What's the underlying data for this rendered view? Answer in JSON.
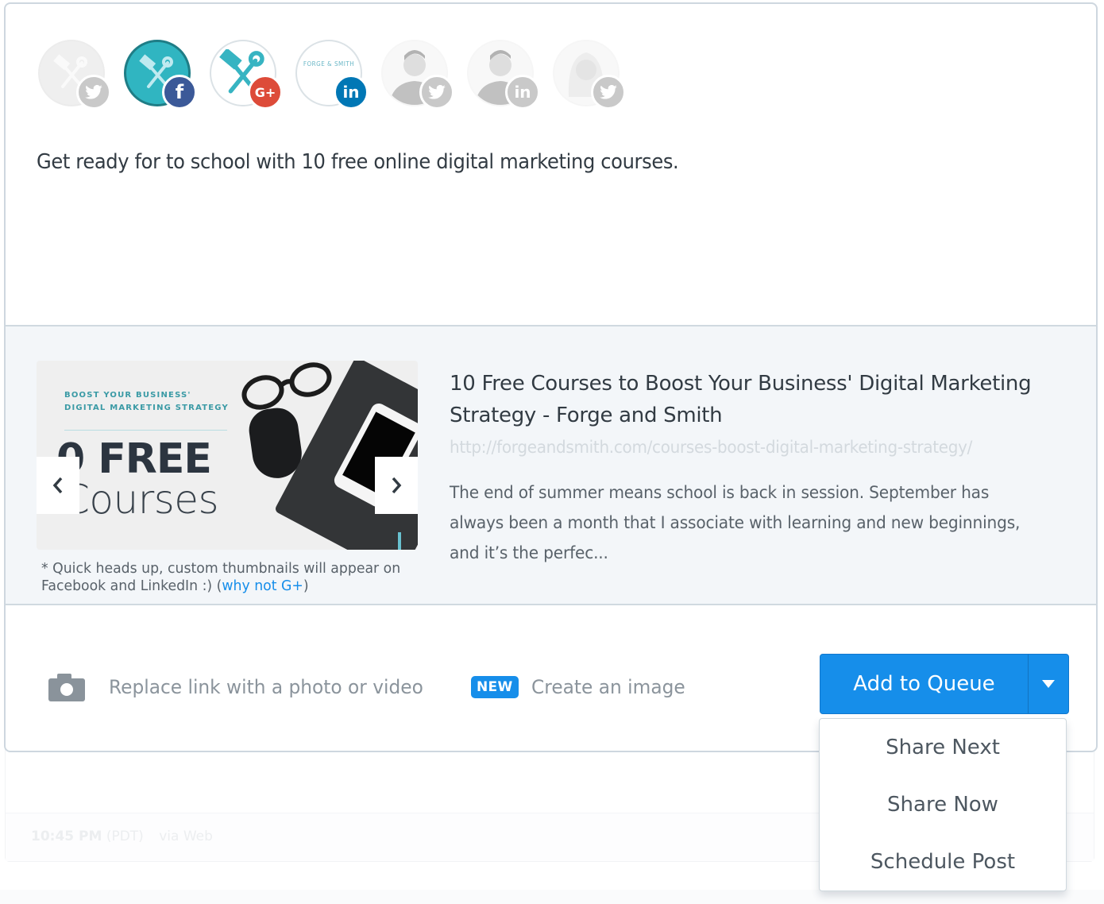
{
  "profiles": [
    {
      "name": "Forge and Smith",
      "network": "twitter",
      "badge_icon": "twitter-icon",
      "selected": false,
      "avatar_style": "fs-gray"
    },
    {
      "name": "Forge and Smith",
      "network": "facebook",
      "badge_icon": "facebook-icon",
      "badge_text": "f",
      "selected": true,
      "avatar_style": "fs-teal"
    },
    {
      "name": "Forge and Smith",
      "network": "googleplus",
      "badge_icon": "google-plus-icon",
      "badge_text": "G+",
      "selected": true,
      "avatar_style": "fs-white"
    },
    {
      "name": "Forge and Smith",
      "network": "linkedin",
      "badge_icon": "linkedin-icon",
      "badge_text": "in",
      "selected": true,
      "avatar_style": "fs-white",
      "logo_text": "FORGE & SMITH"
    },
    {
      "name": "Person profile",
      "network": "twitter",
      "badge_icon": "twitter-icon",
      "selected": false,
      "avatar_style": "person"
    },
    {
      "name": "Person profile",
      "network": "linkedin",
      "badge_icon": "linkedin-icon",
      "badge_text": "in",
      "selected": false,
      "avatar_style": "person"
    },
    {
      "name": "Person profile",
      "network": "twitter",
      "badge_icon": "twitter-icon",
      "selected": false,
      "avatar_style": "person"
    }
  ],
  "composer": {
    "message": "Get ready for to school with 10 free online digital marketing courses."
  },
  "link_preview": {
    "thumbnail": {
      "kicker_line1": "BOOST YOUR BUSINESS'",
      "kicker_line2": "DIGITAL MARKETING STRATEGY",
      "big_text": "0 FREE",
      "sub_text": "Courses"
    },
    "note_prefix": "* Quick heads up, custom thumbnails will appear on Facebook and LinkedIn :) (",
    "note_link": "why not G+",
    "note_suffix": ")",
    "title": "10 Free Courses to Boost Your Business' Digital Marketing Strategy - Forge and Smith",
    "url": "http://forgeandsmith.com/courses-boost-digital-marketing-strategy/",
    "description": "The end of summer means school is back in session. September has always been a month that I associate with learning and new beginnings, and it’s the perfec..."
  },
  "actions": {
    "photo_label": "Replace link with a photo or video",
    "new_badge": "NEW",
    "create_label": "Create an image"
  },
  "queue_button": {
    "label": "Add to Queue",
    "color": "#168eea"
  },
  "dropdown": {
    "items": [
      "Share Next",
      "Share Now",
      "Schedule Post"
    ]
  },
  "background_post": {
    "time": "10:45 PM",
    "timezone": "(PDT)",
    "via": "via Web"
  }
}
